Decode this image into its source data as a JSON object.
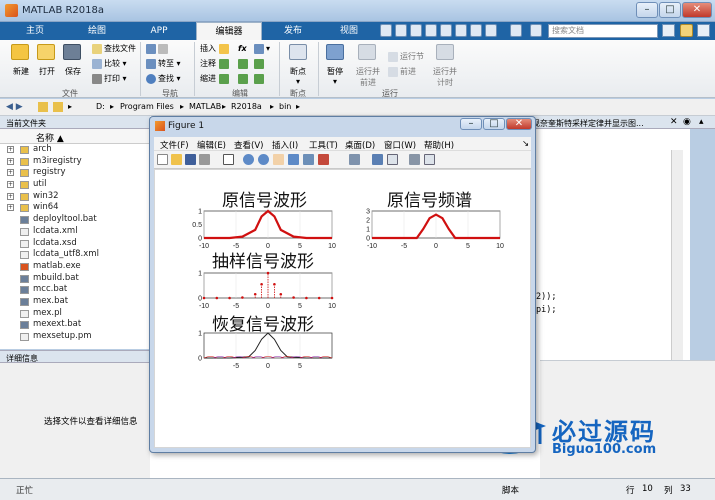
{
  "window": {
    "title": "MATLAB R2018a"
  },
  "tabs": [
    "主页",
    "绘图",
    "APP",
    "编辑器",
    "发布",
    "视图"
  ],
  "active_tab": "编辑器",
  "search": {
    "placeholder": "搜索文档"
  },
  "ribbon": {
    "file": {
      "new": "新建",
      "open": "打开",
      "save": "保存",
      "find_files": "查找文件",
      "compare": "比较",
      "print": "打印",
      "group": "文件"
    },
    "navigate": {
      "goto": "转至",
      "find": "查找",
      "group": "导航"
    },
    "edit": {
      "insert": "插入",
      "comment": "注释",
      "indent": "缩进",
      "fx": "fx",
      "group": "编辑"
    },
    "breakpoints": {
      "label": "断点",
      "group": "断点"
    },
    "run": {
      "pause": "暂停",
      "run_advance": "运行并\n前进",
      "run_section": "运行节",
      "advance": "前进",
      "run_time": "运行并\n计时",
      "group": "运行"
    }
  },
  "address": {
    "parts": [
      "D:",
      "Program Files",
      "MATLAB",
      "R2018a",
      "bin"
    ]
  },
  "current_folder": {
    "title": "当前文件夹",
    "column": "名称 ▲",
    "items": [
      {
        "name": "arch",
        "type": "folder"
      },
      {
        "name": "m3iregistry",
        "type": "folder"
      },
      {
        "name": "registry",
        "type": "folder"
      },
      {
        "name": "util",
        "type": "folder"
      },
      {
        "name": "win32",
        "type": "folder"
      },
      {
        "name": "win64",
        "type": "folder"
      },
      {
        "name": "deployltool.bat",
        "type": "bat"
      },
      {
        "name": "lcdata.xml",
        "type": "xml"
      },
      {
        "name": "lcdata.xsd",
        "type": "xsd"
      },
      {
        "name": "lcdata_utf8.xml",
        "type": "xml"
      },
      {
        "name": "matlab.exe",
        "type": "exe"
      },
      {
        "name": "mbuild.bat",
        "type": "bat"
      },
      {
        "name": "mcc.bat",
        "type": "bat"
      },
      {
        "name": "mex.bat",
        "type": "bat"
      },
      {
        "name": "mex.pl",
        "type": "pl"
      },
      {
        "name": "mexext.bat",
        "type": "bat"
      },
      {
        "name": "mexsetup.pm",
        "type": "pm"
      }
    ]
  },
  "details": {
    "title": "详细信息",
    "message": "选择文件以查看详细信息"
  },
  "editor_tab": {
    "title": "实现奈奎斯特采样定律并显示图..."
  },
  "code": {
    "line1": "2));",
    "line2": "pi);"
  },
  "status": {
    "state": "正忙",
    "script": "脚本",
    "row_label": "行",
    "row": "10",
    "col_label": "列",
    "col": "33"
  },
  "figure": {
    "title": "Figure 1",
    "menu": [
      "文件(F)",
      "编辑(E)",
      "查看(V)",
      "插入(I)",
      "工具(T)",
      "桌面(D)",
      "窗口(W)",
      "帮助(H)"
    ],
    "plots": {
      "p1_title": "原信号波形",
      "p2_title": "原信号频谱",
      "p3_title": "抽样信号波形",
      "p4_title": "恢复信号波形"
    }
  },
  "chart_data": [
    {
      "type": "line",
      "title": "原信号波形",
      "xlim": [
        -10,
        10
      ],
      "ylim": [
        0,
        1
      ],
      "yticks": [
        0,
        0.5,
        1
      ],
      "xticks": [
        -10,
        -5,
        0,
        5,
        10
      ],
      "x": [
        -10,
        -6,
        -4,
        -2,
        -1,
        0,
        1,
        2,
        4,
        6,
        10
      ],
      "y": [
        0,
        0,
        0.05,
        0.3,
        0.8,
        1,
        0.8,
        0.3,
        0.05,
        0,
        0
      ],
      "color": "#d01010"
    },
    {
      "type": "line",
      "title": "原信号频谱",
      "xlim": [
        -10,
        10
      ],
      "ylim": [
        0,
        3
      ],
      "yticks": [
        0,
        1,
        2,
        3
      ],
      "xticks": [
        -10,
        -5,
        0,
        5,
        10
      ],
      "x": [
        -10,
        -3,
        -2,
        -1,
        0,
        1,
        2,
        3,
        10
      ],
      "y": [
        0,
        0,
        1,
        2.2,
        2.6,
        2.2,
        1,
        0,
        0
      ],
      "color": "#d01010"
    },
    {
      "type": "scatter",
      "title": "抽样信号波形",
      "xlim": [
        -10,
        10
      ],
      "ylim": [
        0,
        1
      ],
      "yticks": [
        0,
        1
      ],
      "xticks": [
        -10,
        -5,
        0,
        5,
        10
      ],
      "x": [
        -10,
        -8,
        -6,
        -4,
        -2,
        -1,
        0,
        1,
        2,
        4,
        6,
        8,
        10
      ],
      "y": [
        0,
        0,
        0,
        0.02,
        0.15,
        0.55,
        1,
        0.55,
        0.15,
        0.02,
        0,
        0,
        0
      ],
      "color": "#d01010"
    },
    {
      "type": "line",
      "title": "恢复信号波形",
      "xlim": [
        -10,
        10
      ],
      "ylim": [
        0,
        1
      ],
      "yticks": [
        0,
        1
      ],
      "xticks": [
        -5,
        0,
        5
      ],
      "x": [
        -10,
        -6,
        -3,
        -2,
        -1,
        0,
        1,
        2,
        3,
        6,
        10
      ],
      "y": [
        0,
        0,
        0.05,
        0.3,
        0.75,
        1,
        0.75,
        0.3,
        0.05,
        0,
        0
      ],
      "color": "#222222"
    }
  ],
  "watermark": {
    "text": "必过源码",
    "sub": "Biguo100.com"
  },
  "colors": {
    "tab_bar": "#1f64a5",
    "plot_line": "#d01010"
  }
}
